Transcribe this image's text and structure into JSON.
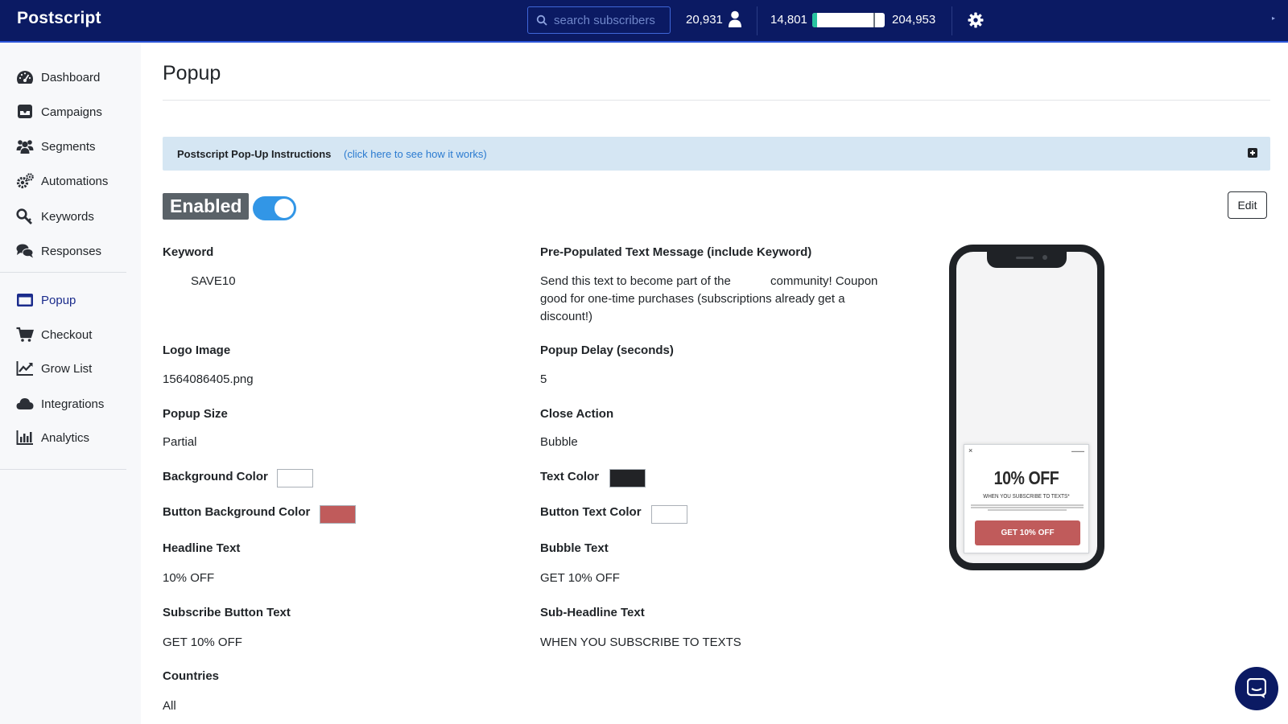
{
  "app": {
    "brand": "Postscript"
  },
  "header": {
    "search_placeholder": "search subscribers",
    "subscriber_count": "20,931",
    "usage_current": "14,801",
    "usage_limit": "204,953",
    "usage_fraction": 0.072
  },
  "sidebar": {
    "items": [
      {
        "label": "Dashboard",
        "icon": "dashboard-icon"
      },
      {
        "label": "Campaigns",
        "icon": "campaigns-icon"
      },
      {
        "label": "Segments",
        "icon": "segments-icon"
      },
      {
        "label": "Automations",
        "icon": "automations-icon"
      },
      {
        "label": "Keywords",
        "icon": "keywords-icon"
      },
      {
        "label": "Responses",
        "icon": "responses-icon"
      },
      {
        "label": "Popup",
        "icon": "popup-icon",
        "active": true
      },
      {
        "label": "Checkout",
        "icon": "cart-icon"
      },
      {
        "label": "Grow List",
        "icon": "chart-line-icon"
      },
      {
        "label": "Integrations",
        "icon": "cloud-icon"
      },
      {
        "label": "Analytics",
        "icon": "bar-chart-icon"
      }
    ]
  },
  "page": {
    "title": "Popup",
    "instructions_title": "Postscript Pop-Up Instructions",
    "instructions_link": "(click here to see how it works)",
    "status_badge": "Enabled",
    "toggle_on": true,
    "edit_label": "Edit"
  },
  "fields": {
    "keyword": {
      "label": "Keyword",
      "value": "SAVE10"
    },
    "prepopulated": {
      "label": "Pre-Populated Text Message (include Keyword)",
      "line1": "Send this text to become part of the",
      "line1b": "community! Coupon",
      "line2": "good for one-time purchases (subscriptions already get a",
      "line3": "discount!)"
    },
    "logo_image": {
      "label": "Logo Image",
      "value": "1564086405.png"
    },
    "popup_delay": {
      "label": "Popup Delay (seconds)",
      "value": "5"
    },
    "popup_size": {
      "label": "Popup Size",
      "value": "Partial"
    },
    "close_action": {
      "label": "Close Action",
      "value": "Bubble"
    },
    "background_color": {
      "label": "Background Color",
      "color": "#ffffff"
    },
    "text_color": {
      "label": "Text Color",
      "color": "#222326"
    },
    "button_background_color": {
      "label": "Button Background Color",
      "color": "#c05b5b"
    },
    "button_text_color": {
      "label": "Button Text Color",
      "color": "#ffffff"
    },
    "headline_text": {
      "label": "Headline Text",
      "value": "10% OFF"
    },
    "bubble_text": {
      "label": "Bubble Text",
      "value": "GET 10% OFF"
    },
    "subscribe_button_text": {
      "label": "Subscribe Button Text",
      "value": "GET 10% OFF"
    },
    "subheadline_text": {
      "label": "Sub-Headline Text",
      "value": "WHEN YOU SUBSCRIBE TO TEXTS"
    },
    "countries": {
      "label": "Countries",
      "value": "All"
    }
  },
  "preview": {
    "close": "×",
    "headline": "10% OFF",
    "subheadline": "WHEN YOU SUBSCRIBE TO TEXTS*",
    "button": "GET 10% OFF"
  },
  "colors": {
    "topbar": "#0b1a63",
    "accent": "#3296e6",
    "progress": "#27c3a0"
  }
}
